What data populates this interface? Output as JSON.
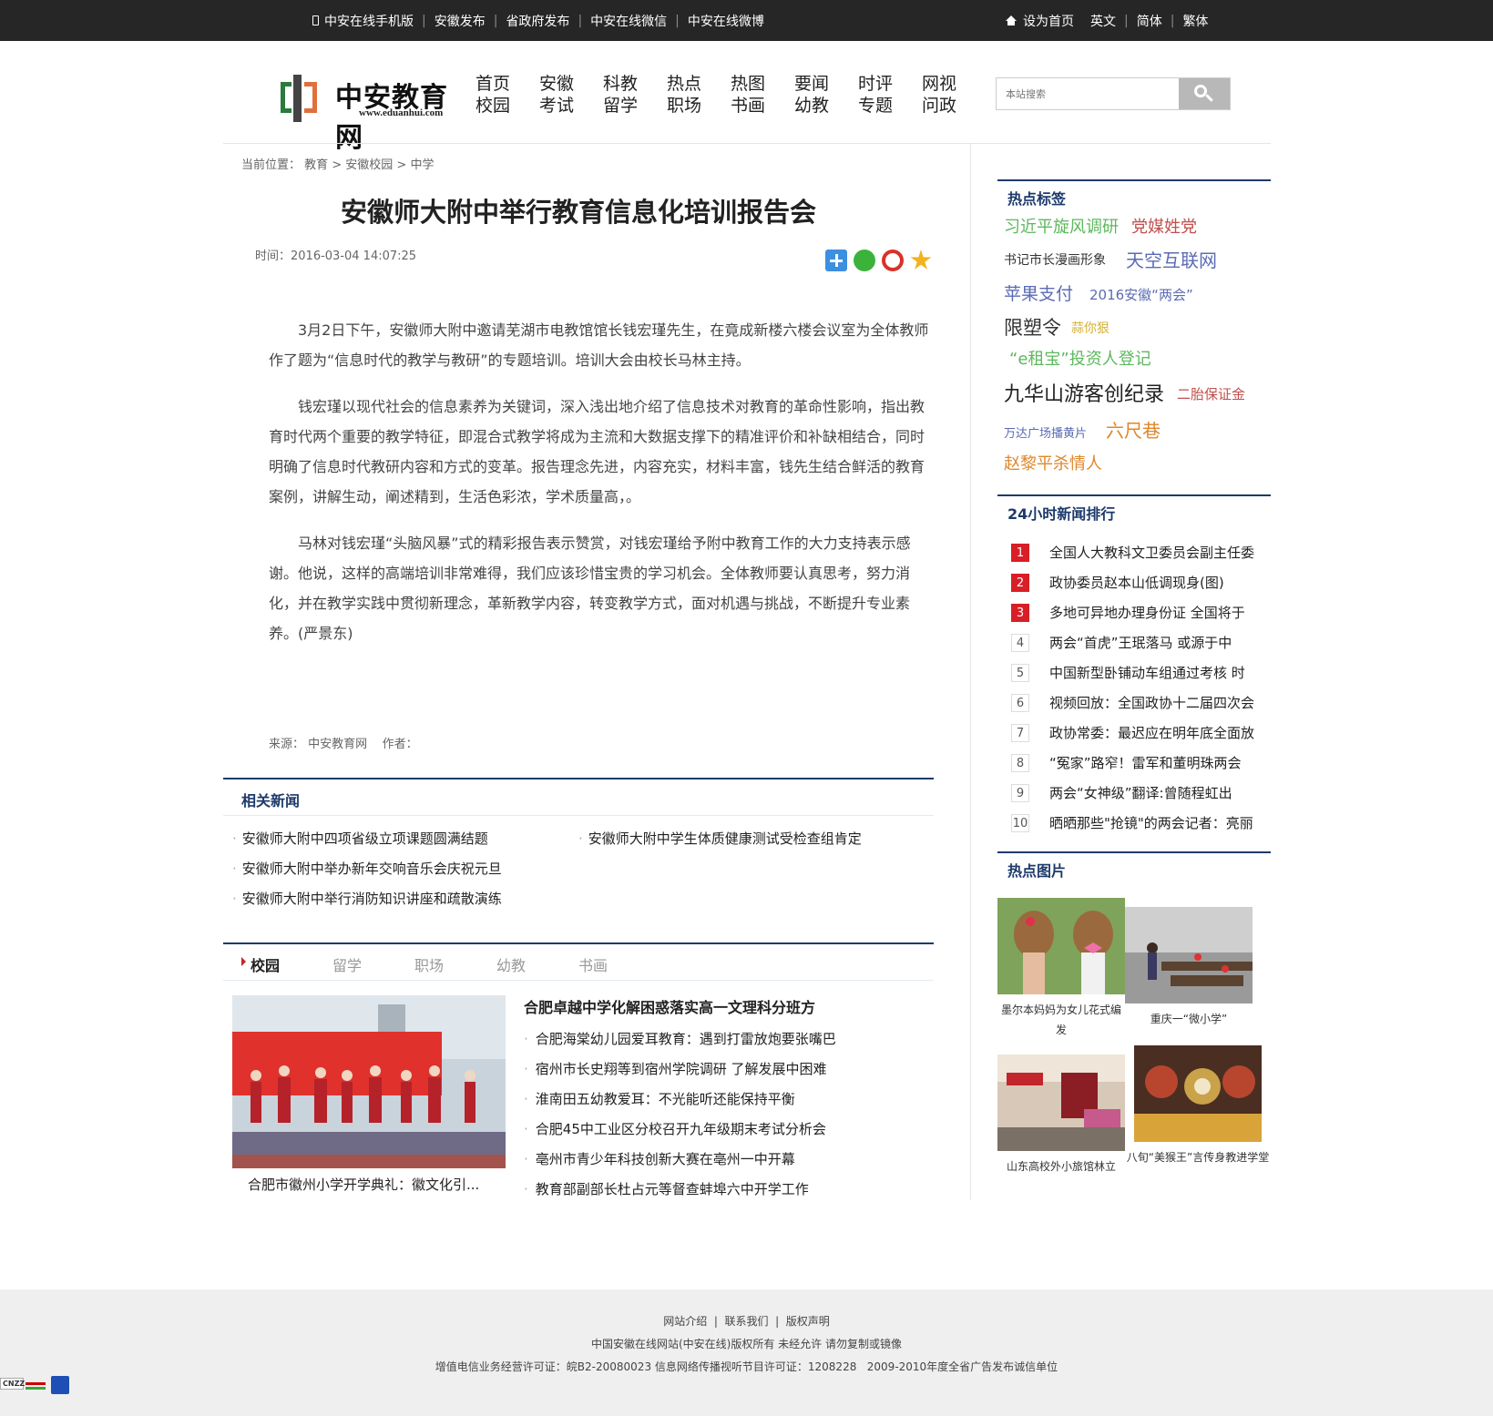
{
  "topbar": {
    "left": [
      "中安在线手机版",
      "安徽发布",
      "省政府发布",
      "中安在线微信",
      "中安在线微博"
    ],
    "right": [
      "设为首页",
      "英文",
      "简体",
      "繁体"
    ]
  },
  "logo": {
    "text": "中安教育网",
    "url": "www.eduanhui.com"
  },
  "nav": [
    [
      "首页",
      "校园"
    ],
    [
      "安徽",
      "考试"
    ],
    [
      "科教",
      "留学"
    ],
    [
      "热点",
      "职场"
    ],
    [
      "热图",
      "书画"
    ],
    [
      "要闻",
      "幼教"
    ],
    [
      "时评",
      "专题"
    ],
    [
      "网视",
      "问政"
    ]
  ],
  "search": {
    "placeholder": "本站搜索"
  },
  "breadcrumb": "当前位置： 教育 > 安徽校园 > 中学",
  "article": {
    "title": "安徽师大附中举行教育信息化培训报告会",
    "time": "时间：2016-03-04 14:07:25",
    "paragraphs": [
      "3月2日下午，安徽师大附中邀请芜湖市电教馆馆长钱宏瑾先生，在竟成新楼六楼会议室为全体教师作了题为“信息时代的教学与教研”的专题培训。培训大会由校长马林主持。",
      "钱宏瑾以现代社会的信息素养为关键词，深入浅出地介绍了信息技术对教育的革命性影响，指出教育时代两个重要的教学特征，即混合式教学将成为主流和大数据支撑下的精准评价和补缺相结合，同时明确了信息时代教研内容和方式的变革。报告理念先进，内容充实，材料丰富，钱先生结合鲜活的教育案例，讲解生动，阐述精到，生活色彩浓，学术质量高，。",
      "马林对钱宏瑾“头脑风暴”式的精彩报告表示赞赏，对钱宏瑾给予附中教育工作的大力支持表示感谢。他说，这样的高端培训非常难得，我们应该珍惜宝贵的学习机会。全体教师要认真思考，努力消化，并在教学实践中贯彻新理念，革新教学内容，转变教学方式，面对机遇与挑战，不断提升专业素养。(严景东)"
    ],
    "source": "来源： 中安教育网    作者："
  },
  "related": {
    "heading": "相关新闻",
    "items": [
      "安徽师大附中四项省级立项课题圆满结题",
      "安徽师大附中学生体质健康测试受检查组肯定",
      "安徽师大附中举办新年交响音乐会庆祝元旦",
      "安徽师大附中举行消防知识讲座和疏散演练"
    ]
  },
  "tabs": {
    "items": [
      "校园",
      "留学",
      "职场",
      "幼教",
      "书画"
    ],
    "photo_caption": "合肥市徽州小学开学典礼：徽文化引...",
    "lead": "合肥卓越中学化解困惑落实高一文理科分班方",
    "list": [
      "合肥海棠幼儿园爱耳教育：遇到打雷放炮要张嘴巴",
      "宿州市长史翔等到宿州学院调研 了解发展中困难",
      "淮南田五幼教爱耳：不光能听还能保持平衡",
      "合肥45中工业区分校召开九年级期末考试分析会",
      "亳州市青少年科技创新大赛在亳州一中开幕",
      "教育部副部长杜占元等督查蚌埠六中开学工作"
    ]
  },
  "sidebar": {
    "tags_heading": "热点标签",
    "tags": [
      "习近平旋风调研",
      "党媒姓党",
      "书记市长漫画形象",
      "天空互联网",
      "苹果支付",
      "2016安徽“两会”",
      "限塑令",
      "蒜你狠",
      "“e租宝”投资人登记",
      "九华山游客创纪录",
      "二胎保证金",
      "万达广场播黄片",
      "六尺巷",
      "赵黎平杀情人"
    ],
    "tag_colors": [
      "#5cb85c",
      "#c0504d",
      "#333333",
      "#5b6bb5",
      "#5b6bb5",
      "#5b6bb5",
      "#333333",
      "#d4b030",
      "#5cb85c",
      "#222222",
      "#c0504d",
      "#5b6bb5",
      "#e0872a",
      "#e0872a"
    ],
    "rank_heading": "24小时新闻排行",
    "rank": [
      {
        "n": "1",
        "t": "全国人大教科文卫委员会副主任委"
      },
      {
        "n": "2",
        "t": "政协委员赵本山低调现身(图)"
      },
      {
        "n": "3",
        "t": "多地可异地办理身份证 全国将于"
      },
      {
        "n": "4",
        "t": "两会“首虎”王珉落马 或源于中"
      },
      {
        "n": "5",
        "t": "中国新型卧铺动车组通过考核 时"
      },
      {
        "n": "6",
        "t": "视频回放：全国政协十二届四次会"
      },
      {
        "n": "7",
        "t": "政协常委：最迟应在明年底全面放"
      },
      {
        "n": "8",
        "t": "“冤家”路窄！雷军和董明珠两会"
      },
      {
        "n": "9",
        "t": "两会“女神级”翻译:曾随程虹出"
      },
      {
        "n": "10",
        "t": "晒晒那些\"抢镜\"的两会记者：亮丽"
      }
    ],
    "pics_heading": "热点图片",
    "pics": [
      "墨尔本妈妈为女儿花式编发",
      "重庆一“微小学”",
      "山东高校外小旅馆林立",
      "八旬“美猴王”言传身教进学堂"
    ]
  },
  "footer": {
    "links": "网站介绍  |  联系我们  |  版权声明",
    "copyright": "中国安徽在线网站(中安在线)版权所有 未经允许 请勿复制或镜像",
    "license": "增值电信业务经营许可证：皖B2-20080023 信息网络传播视听节目许可证：1208228   2009-2010年度全省广告发布诚信单位",
    "badge": "CNZZ"
  }
}
